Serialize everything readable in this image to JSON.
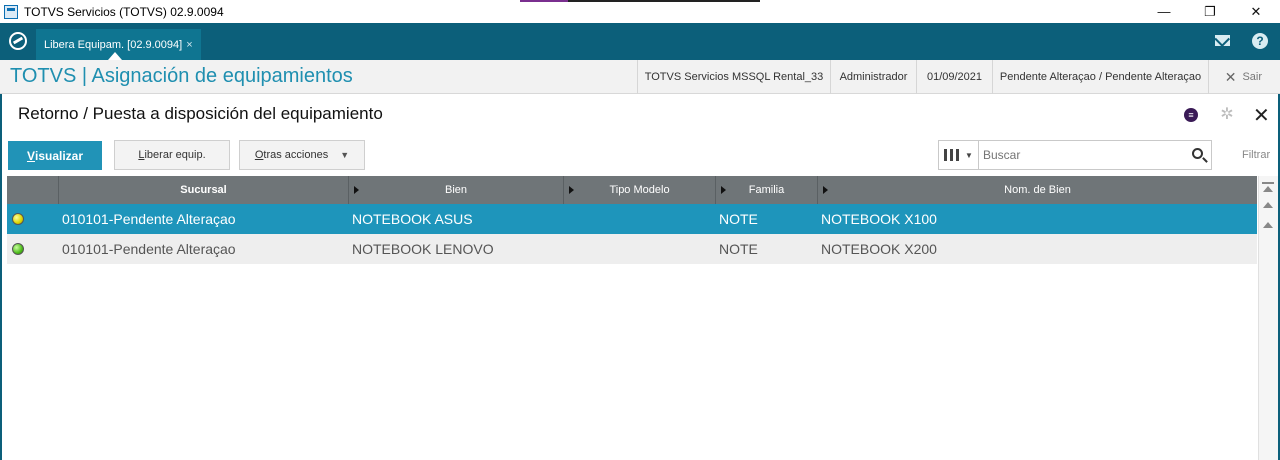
{
  "window": {
    "title": "TOTVS Servicios (TOTVS) 02.9.0094",
    "minimize": "—",
    "maximize": "❐",
    "close": "✕"
  },
  "appbar": {
    "tab_label": "Libera Equipam. [02.9.0094]",
    "tab_close": "×",
    "help": "?"
  },
  "header": {
    "title": "TOTVS | Asignación de equipamientos",
    "environment": "TOTVS Servicios MSSQL Rental_33",
    "user": "Administrador",
    "date": "01/09/2021",
    "status": "Pendente Alteraçao / Pendente Alteraçao",
    "logout_label": "Sair",
    "logout_icon": "✕"
  },
  "screen": {
    "title": "Retorno / Puesta a disposición del equipamiento",
    "close_icon": "✕",
    "help_badge": "≡",
    "gear": "✲"
  },
  "toolbar": {
    "visualizar_first": "V",
    "visualizar_rest": "isualizar",
    "liberar_first": "L",
    "liberar_rest": "iberar equip.",
    "otras_first": "O",
    "otras_rest": "tras acciones",
    "otras_caret": "▼",
    "search_placeholder": "Buscar",
    "search_value": "",
    "filter_label": "Filtrar",
    "cols_caret": "▼"
  },
  "grid": {
    "columns": [
      "Sucursal",
      "Bien",
      "Tipo Modelo",
      "Familia",
      "Nom. de Bien"
    ],
    "rows": [
      {
        "status": "yellow",
        "sucursal": "010101-Pendente Alteraçao",
        "bien": "NOTEBOOK ASUS",
        "tipo_modelo": "",
        "familia": "NOTE",
        "nom_bien": "NOTEBOOK X100",
        "selected": true
      },
      {
        "status": "green",
        "sucursal": "010101-Pendente Alteraçao",
        "bien": "NOTEBOOK LENOVO",
        "tipo_modelo": "",
        "familia": "NOTE",
        "nom_bien": "NOTEBOOK X200",
        "selected": false
      }
    ]
  },
  "colors": {
    "brand": "#0c5f7a",
    "accent": "#1f8fb0",
    "selected_row": "#1e95bb",
    "primary_button": "#2193b7"
  }
}
